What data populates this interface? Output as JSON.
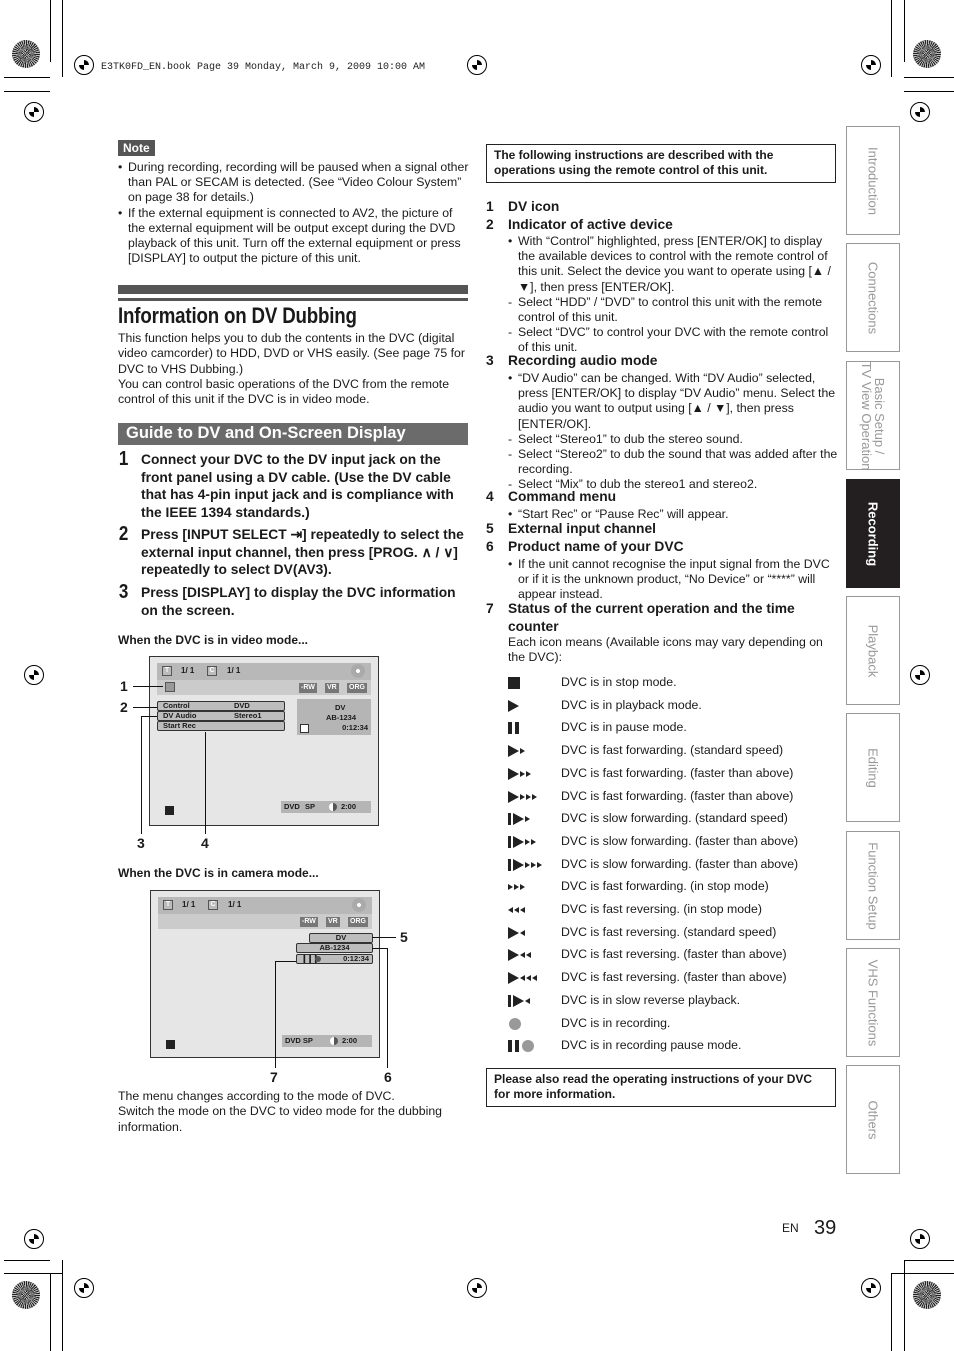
{
  "print_header": "E3TK0FD_EN.book  Page 39  Monday, March 9, 2009  10:00 AM",
  "note": {
    "label": "Note",
    "bullets": [
      "During recording, recording will be paused when a signal other than PAL or SECAM is detected. (See “Video Colour System” on page 38 for details.)",
      "If the external equipment is connected to AV2, the picture of the external equipment will be output except during the DVD playback of this unit. Turn off the external equipment or press [DISPLAY] to output the picture of this unit."
    ]
  },
  "section": {
    "title": "Information on DV Dubbing",
    "intro_1": "This function helps you to dub the contents in the DVC (digital video camcorder) to HDD, DVD or VHS easily. (See page 75 for DVC to VHS Dubbing.)",
    "intro_2": "You can control basic operations of the DVC from the remote control of this unit if the DVC is in video mode.",
    "subheading": "Guide to DV and On-Screen Display"
  },
  "steps": [
    {
      "num": "1",
      "text": "Connect your DVC to the DV input jack on the front panel using a DV cable. (Use the DV cable that has 4-pin input jack and is compliance with the IEEE 1394 standards.)"
    },
    {
      "num": "2",
      "text": "Press [INPUT SELECT ⇥] repeatedly to select the external input channel, then press [PROG. ∧ / ∨] repeatedly to select DV(AV3)."
    },
    {
      "num": "3",
      "text": "Press [DISPLAY] to display the DVC information on the screen."
    }
  ],
  "video_mode": {
    "caption": "When the DVC is in video mode...",
    "osd": {
      "title_label": "T",
      "title_count": "1/  1",
      "chapter_label": "C",
      "chapter_count": "1/  1",
      "tags": [
        "-RW",
        "VR",
        "ORG"
      ],
      "menu": [
        {
          "label": "Control",
          "value": "DVD"
        },
        {
          "label": "DV Audio",
          "value": "Stereo1"
        },
        {
          "label": "Start Rec",
          "value": ""
        }
      ],
      "info": {
        "channel": "DV",
        "product": "AB-1234",
        "time": "0:12:34"
      },
      "status": {
        "disc": "DVD",
        "mode": "SP",
        "remaining": "2:00"
      }
    },
    "callouts": [
      "1",
      "2",
      "3",
      "4"
    ]
  },
  "camera_mode": {
    "caption": "When the DVC is in camera mode...",
    "osd": {
      "title_label": "T",
      "title_count": "1/  1",
      "chapter_label": "C",
      "chapter_count": "1/  1",
      "tags": [
        "-RW",
        "VR",
        "ORG"
      ],
      "info": {
        "channel": "DV",
        "product": "AB-1234",
        "time": "0:12:34"
      },
      "status": {
        "disc_mode": "DVD SP",
        "remaining": "2:00"
      }
    },
    "callouts": [
      "5",
      "6",
      "7"
    ]
  },
  "footer_note": "The menu changes according to the mode of DVC.\nSwitch the mode on the DVC to video mode for the dubbing information.",
  "remote_box": "The following instructions are described with the operations using the remote control of this unit.",
  "items": [
    {
      "num": "1",
      "title": "DV icon"
    },
    {
      "num": "2",
      "title": "Indicator of active device",
      "bullet": "With “Control” highlighted, press [ENTER/OK] to display the available devices to control with the remote control of this unit. Select the device you want to operate using [▲ / ▼], then press [ENTER/OK].",
      "dashes": [
        "Select “HDD” / “DVD” to control this unit with the remote control of this unit.",
        "Select “DVC” to control your DVC with the remote control of this unit."
      ]
    },
    {
      "num": "3",
      "title": "Recording audio mode",
      "bullet": "“DV Audio” can be changed. With “DV Audio” selected, press [ENTER/OK] to display “DV Audio” menu. Select the audio you want to output using [▲ / ▼], then press [ENTER/OK].",
      "dashes": [
        "Select “Stereo1” to dub the stereo sound.",
        "Select “Stereo2” to dub the sound that was added after the recording.",
        "Select “Mix” to dub the stereo1 and stereo2."
      ]
    },
    {
      "num": "4",
      "title": "Command menu",
      "bullet": "“Start Rec” or “Pause Rec” will appear."
    },
    {
      "num": "5",
      "title": "External input channel"
    },
    {
      "num": "6",
      "title": "Product name of your DVC",
      "bullet": "If the unit cannot recognise the input signal from the DVC or if it is the unknown product, “No Device” or “****” will appear instead."
    },
    {
      "num": "7",
      "title": "Status of the current operation and the time counter",
      "body": "Each icon means (Available icons may vary depending on the DVC):"
    }
  ],
  "status_icons": [
    {
      "icon": "stop-icon",
      "text": "DVC is in stop mode."
    },
    {
      "icon": "play-icon",
      "text": "DVC is in playback mode."
    },
    {
      "icon": "pause-icon",
      "text": "DVC is in pause mode."
    },
    {
      "icon": "fast-forward-1-icon",
      "text": "DVC is fast forwarding. (standard speed)"
    },
    {
      "icon": "fast-forward-2-icon",
      "text": "DVC is fast forwarding. (faster than above)"
    },
    {
      "icon": "fast-forward-3-icon",
      "text": "DVC is fast forwarding. (faster than above)"
    },
    {
      "icon": "slow-forward-1-icon",
      "text": "DVC is slow forwarding. (standard speed)"
    },
    {
      "icon": "slow-forward-2-icon",
      "text": "DVC is slow forwarding. (faster than above)"
    },
    {
      "icon": "slow-forward-3-icon",
      "text": "DVC is slow forwarding. (faster than above)"
    },
    {
      "icon": "stop-fast-forward-icon",
      "text": "DVC is fast forwarding. (in stop mode)"
    },
    {
      "icon": "stop-fast-reverse-icon",
      "text": "DVC is fast reversing. (in stop mode)"
    },
    {
      "icon": "fast-reverse-1-icon",
      "text": "DVC is fast reversing. (standard speed)"
    },
    {
      "icon": "fast-reverse-2-icon",
      "text": "DVC is fast reversing. (faster than above)"
    },
    {
      "icon": "fast-reverse-3-icon",
      "text": "DVC is fast reversing. (faster than above)"
    },
    {
      "icon": "slow-reverse-icon",
      "text": "DVC is in slow reverse playback."
    },
    {
      "icon": "record-icon",
      "text": "DVC is in recording."
    },
    {
      "icon": "record-pause-icon",
      "text": "DVC is in recording pause mode."
    }
  ],
  "read_also_box": "Please also read the operating instructions of your DVC for more information.",
  "side_tabs": [
    {
      "label": "Introduction",
      "active": false
    },
    {
      "label": "Connections",
      "active": false
    },
    {
      "label": "Basic Setup /\nTV View Operation",
      "active": false
    },
    {
      "label": "Recording",
      "active": true
    },
    {
      "label": "Playback",
      "active": false
    },
    {
      "label": "Editing",
      "active": false
    },
    {
      "label": "Function Setup",
      "active": false
    },
    {
      "label": "VHS Functions",
      "active": false
    },
    {
      "label": "Others",
      "active": false
    }
  ],
  "page": {
    "lang": "EN",
    "number": "39"
  }
}
